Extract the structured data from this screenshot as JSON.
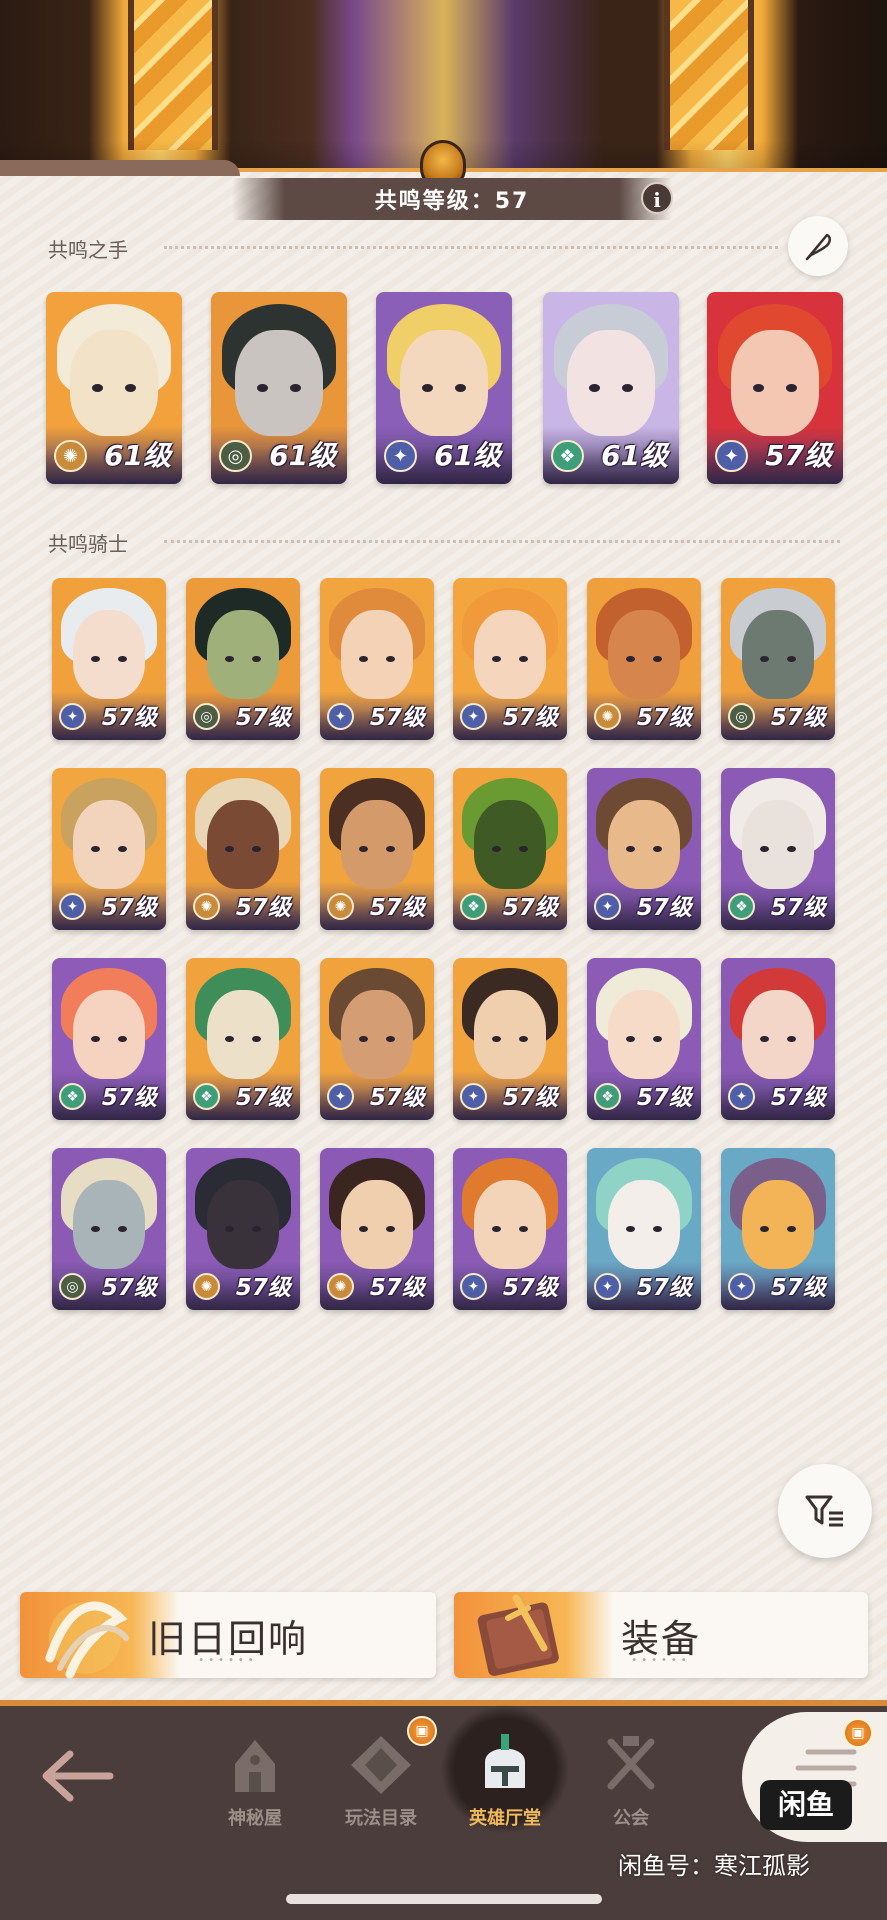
{
  "header": {
    "level_label": "共鸣等级：57",
    "info_label": "i"
  },
  "sections": {
    "hands_title": "共鸣之手",
    "knights_title": "共鸣骑士"
  },
  "hands": [
    {
      "level": "61级",
      "class_icon": "sun-class-icon",
      "bg": "#f2a13c",
      "hair": "#f4ead8",
      "skin": "#f2e2c8",
      "badge": "#c98a3a",
      "glyph": "✺"
    },
    {
      "level": "61级",
      "class_icon": "nature-class-icon",
      "bg": "#e9963a",
      "hair": "#2d3330",
      "skin": "#c9c4bf",
      "badge": "#4d5d44",
      "glyph": "◎"
    },
    {
      "level": "61级",
      "class_icon": "star-class-icon",
      "bg": "#8a5fb8",
      "hair": "#f0cf68",
      "skin": "#f3d8bd",
      "badge": "#4e5fa8",
      "glyph": "✦"
    },
    {
      "level": "61级",
      "class_icon": "leaf-class-icon",
      "bg": "#c9b6e6",
      "hair": "#c7ccd6",
      "skin": "#f3e2e2",
      "badge": "#3e9e7a",
      "glyph": "❖"
    },
    {
      "level": "57级",
      "class_icon": "star-class-icon",
      "bg": "#d8333c",
      "hair": "#e0492f",
      "skin": "#f3c7b2",
      "badge": "#4e5fa8",
      "glyph": "✦"
    }
  ],
  "knights": [
    {
      "level": "57级",
      "class_icon": "star-class-icon",
      "bg": "#f0a13c",
      "hair": "#e9ecef",
      "skin": "#f4ddcd",
      "badge": "#4e5fa8",
      "glyph": "✦"
    },
    {
      "level": "57级",
      "class_icon": "nature-class-icon",
      "bg": "#ec9a3a",
      "hair": "#1e2a25",
      "skin": "#9fb07a",
      "badge": "#4d5d44",
      "glyph": "◎"
    },
    {
      "level": "57级",
      "class_icon": "star-class-icon",
      "bg": "#f2a53e",
      "hair": "#e08a3c",
      "skin": "#f3d2b6",
      "badge": "#4e5fa8",
      "glyph": "✦"
    },
    {
      "level": "57级",
      "class_icon": "star-class-icon",
      "bg": "#f3a63f",
      "hair": "#f09a3b",
      "skin": "#f5d6bd",
      "badge": "#4e5fa8",
      "glyph": "✦"
    },
    {
      "level": "57级",
      "class_icon": "sun-class-icon",
      "bg": "#ef9f3b",
      "hair": "#c2612e",
      "skin": "#d6864d",
      "badge": "#c98a3a",
      "glyph": "✺"
    },
    {
      "level": "57级",
      "class_icon": "nature-class-icon",
      "bg": "#f0a13c",
      "hair": "#c9ccd1",
      "skin": "#6c7a72",
      "badge": "#4d5d44",
      "glyph": "◎"
    },
    {
      "level": "57级",
      "class_icon": "star-class-icon",
      "bg": "#f2a63f",
      "hair": "#c9a260",
      "skin": "#f2d3bc",
      "badge": "#4e5fa8",
      "glyph": "✦"
    },
    {
      "level": "57级",
      "class_icon": "sun-class-icon",
      "bg": "#efa03d",
      "hair": "#e9d6b5",
      "skin": "#7a4a35",
      "badge": "#c98a3a",
      "glyph": "✺"
    },
    {
      "level": "57级",
      "class_icon": "sun-class-icon",
      "bg": "#f1a43e",
      "hair": "#4a2f22",
      "skin": "#d59a6a",
      "badge": "#c98a3a",
      "glyph": "✺"
    },
    {
      "level": "57级",
      "class_icon": "leaf-class-icon",
      "bg": "#f0a23d",
      "hair": "#6a9a32",
      "skin": "#3f5a24",
      "badge": "#3e9e7a",
      "glyph": "❖"
    },
    {
      "level": "57级",
      "class_icon": "star-class-icon",
      "bg": "#8a5ab5",
      "hair": "#6e4a34",
      "skin": "#e8b98a",
      "badge": "#4e5fa8",
      "glyph": "✦"
    },
    {
      "level": "57级",
      "class_icon": "leaf-class-icon",
      "bg": "#8a5ab5",
      "hair": "#f0ebe6",
      "skin": "#e9e2dc",
      "badge": "#3e9e7a",
      "glyph": "❖"
    },
    {
      "level": "57级",
      "class_icon": "leaf-class-icon",
      "bg": "#8e5cb8",
      "hair": "#f27d5a",
      "skin": "#f6d2c0",
      "badge": "#3e9e7a",
      "glyph": "❖"
    },
    {
      "level": "57级",
      "class_icon": "leaf-class-icon",
      "bg": "#f0a23d",
      "hair": "#3f8e5a",
      "skin": "#ede0c9",
      "badge": "#3e9e7a",
      "glyph": "❖"
    },
    {
      "level": "57级",
      "class_icon": "star-class-icon",
      "bg": "#f0a23d",
      "hair": "#6b4a34",
      "skin": "#d59d74",
      "badge": "#4e5fa8",
      "glyph": "✦"
    },
    {
      "level": "57级",
      "class_icon": "star-class-icon",
      "bg": "#f1a33e",
      "hair": "#3a2a22",
      "skin": "#f0cfae",
      "badge": "#4e5fa8",
      "glyph": "✦"
    },
    {
      "level": "57级",
      "class_icon": "leaf-class-icon",
      "bg": "#8b5bb6",
      "hair": "#f0ead8",
      "skin": "#f6dcc8",
      "badge": "#3e9e7a",
      "glyph": "❖"
    },
    {
      "level": "57级",
      "class_icon": "star-class-icon",
      "bg": "#8a5ab5",
      "hair": "#d23a3a",
      "skin": "#f3d6c8",
      "badge": "#4e5fa8",
      "glyph": "✦"
    },
    {
      "level": "57级",
      "class_icon": "nature-class-icon",
      "bg": "#8a5ab5",
      "hair": "#e7dcc4",
      "skin": "#a9b4b8",
      "badge": "#4d5d44",
      "glyph": "◎"
    },
    {
      "level": "57级",
      "class_icon": "sun-class-icon",
      "bg": "#8c5cb7",
      "hair": "#2b2b35",
      "skin": "#39323a",
      "badge": "#c98a3a",
      "glyph": "✺"
    },
    {
      "level": "57级",
      "class_icon": "sun-class-icon",
      "bg": "#8a5ab5",
      "hair": "#3a2520",
      "skin": "#f0cfae",
      "badge": "#c98a3a",
      "glyph": "✺"
    },
    {
      "level": "57级",
      "class_icon": "star-class-icon",
      "bg": "#8b5bb6",
      "hair": "#e07a2e",
      "skin": "#f3d4b8",
      "badge": "#4e5fa8",
      "glyph": "✦"
    },
    {
      "level": "57级",
      "class_icon": "star-class-icon",
      "bg": "#6aa9c6",
      "hair": "#8fd2c6",
      "skin": "#f3eee9",
      "badge": "#4e5fa8",
      "glyph": "✦"
    },
    {
      "level": "57级",
      "class_icon": "star-class-icon",
      "bg": "#6aa9c6",
      "hair": "#7a5f8a",
      "skin": "#f2b457",
      "badge": "#4e5fa8",
      "glyph": "✦"
    }
  ],
  "panels": {
    "old_echo": "旧日回响",
    "equipment": "装备",
    "dots": "••••••"
  },
  "nav": {
    "tabs": [
      {
        "label": "神秘屋",
        "icon": "house-icon"
      },
      {
        "label": "玩法目录",
        "icon": "catalog-icon"
      },
      {
        "label": "英雄厅堂",
        "icon": "helmet-icon"
      },
      {
        "label": "公会",
        "icon": "swords-icon"
      }
    ],
    "gift_glyph": "▣"
  },
  "watermark": {
    "logo": "闲鱼",
    "text": "闲鱼号：寒江孤影"
  }
}
